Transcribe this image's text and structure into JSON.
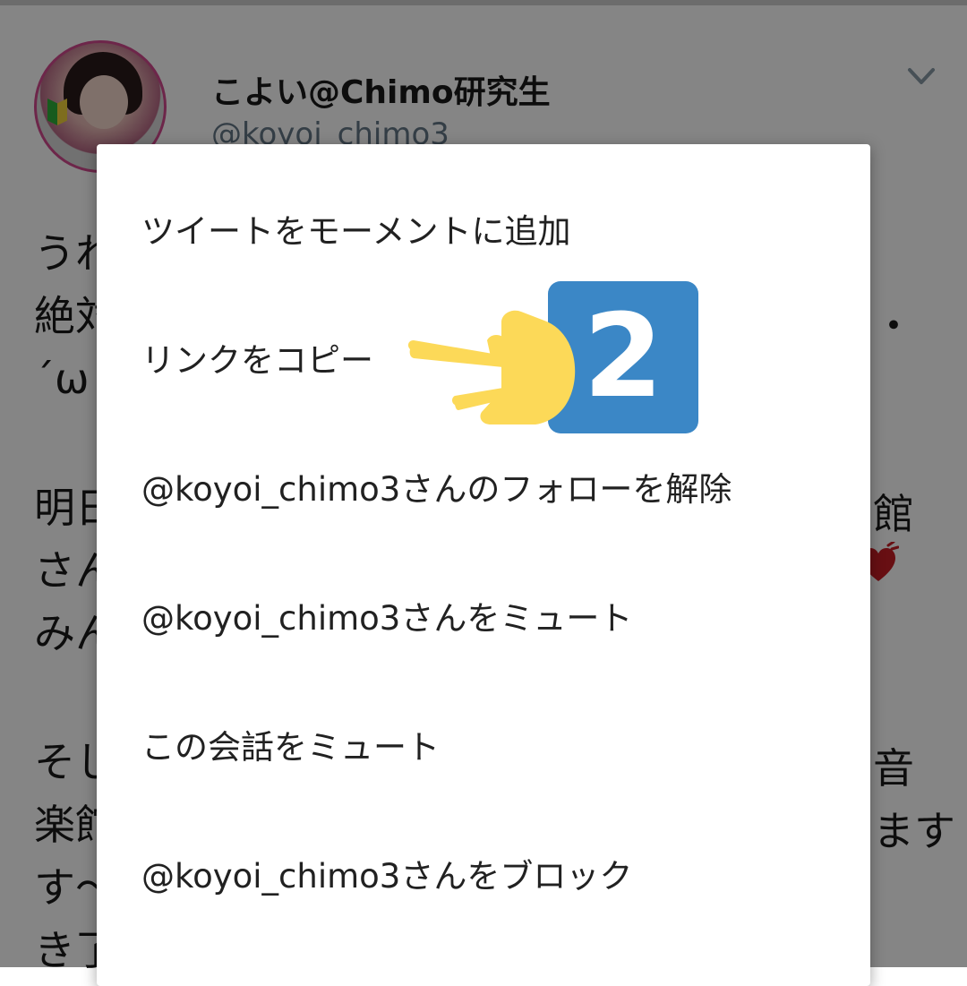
{
  "tweet": {
    "display_name": "こよい@Chimo研究生",
    "handle": "@koyoi_chimo3",
    "lines": [
      "うれ",
      "絶対",
      "´ω",
      "明日",
      "さん",
      "みん",
      "そし",
      "楽館",
      "す〜",
      "き了"
    ],
    "right_fragments": [
      "・",
      "館",
      "音",
      "ます"
    ]
  },
  "menu": {
    "items": [
      "ツイートをモーメントに追加",
      "リンクをコピー",
      "@koyoi_chimo3さんのフォローを解除",
      "@koyoi_chimo3さんをミュート",
      "この会話をミュート",
      "@koyoi_chimo3さんをブロック"
    ]
  },
  "annotation": {
    "step_number": "2",
    "badge_color": "#3b87c6",
    "pointer_color": "#fcd958"
  },
  "icons": {
    "chevron": "chevron-down-icon",
    "pointer": "pointing-hand-icon",
    "heart": "heart-icon"
  }
}
